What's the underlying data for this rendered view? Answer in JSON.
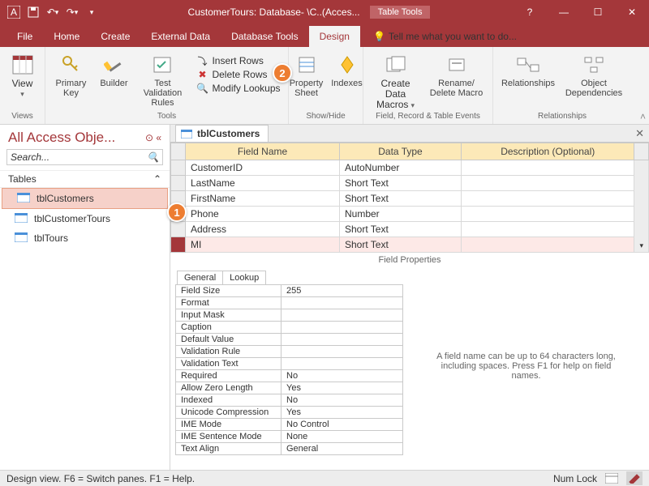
{
  "title": "CustomerTours: Database- \\C..(Acces...",
  "tooltab": "Table Tools",
  "winbuttons": {
    "help": "?",
    "min": "—",
    "max": "☐",
    "close": "✕"
  },
  "tabs": [
    "File",
    "Home",
    "Create",
    "External Data",
    "Database Tools",
    "Design"
  ],
  "tell_me": "Tell me what you want to do...",
  "ribbon": {
    "views": {
      "view": "View",
      "group": "Views"
    },
    "tools": {
      "primary": "Primary Key",
      "builder": "Builder",
      "test": "Test Validation Rules",
      "insert": "Insert Rows",
      "delete": "Delete Rows",
      "modify": "Modify Lookups",
      "group": "Tools"
    },
    "showhide": {
      "prop": "Property Sheet",
      "indexes": "Indexes",
      "group": "Show/Hide"
    },
    "events": {
      "create": "Create Data Macros",
      "rename": "Rename/ Delete Macro",
      "group": "Field, Record & Table Events"
    },
    "rel": {
      "rel": "Relationships",
      "obj": "Object Dependencies",
      "group": "Relationships"
    }
  },
  "nav": {
    "header": "All Access Obje...",
    "search": "Search...",
    "section": "Tables",
    "items": [
      "tblCustomers",
      "tblCustomerTours",
      "tblTours"
    ]
  },
  "doc_tab": "tblCustomers",
  "columns": [
    "Field Name",
    "Data Type",
    "Description (Optional)"
  ],
  "rows": [
    {
      "name": "CustomerID",
      "type": "AutoNumber"
    },
    {
      "name": "LastName",
      "type": "Short Text"
    },
    {
      "name": "FirstName",
      "type": "Short Text"
    },
    {
      "name": "Phone",
      "type": "Number"
    },
    {
      "name": "Address",
      "type": "Short Text"
    },
    {
      "name": "MI",
      "type": "Short Text"
    }
  ],
  "fp_label": "Field Properties",
  "prop_tabs": [
    "General",
    "Lookup"
  ],
  "props": [
    [
      "Field Size",
      "255"
    ],
    [
      "Format",
      ""
    ],
    [
      "Input Mask",
      ""
    ],
    [
      "Caption",
      ""
    ],
    [
      "Default Value",
      ""
    ],
    [
      "Validation Rule",
      ""
    ],
    [
      "Validation Text",
      ""
    ],
    [
      "Required",
      "No"
    ],
    [
      "Allow Zero Length",
      "Yes"
    ],
    [
      "Indexed",
      "No"
    ],
    [
      "Unicode Compression",
      "Yes"
    ],
    [
      "IME Mode",
      "No Control"
    ],
    [
      "IME Sentence Mode",
      "None"
    ],
    [
      "Text Align",
      "General"
    ]
  ],
  "hint": "A field name can be up to 64 characters long, including spaces. Press F1 for help on field names.",
  "status_left": "Design view.   F6 = Switch panes.   F1 = Help.",
  "status_right": "Num Lock",
  "callouts": {
    "1": "1",
    "2": "2"
  }
}
